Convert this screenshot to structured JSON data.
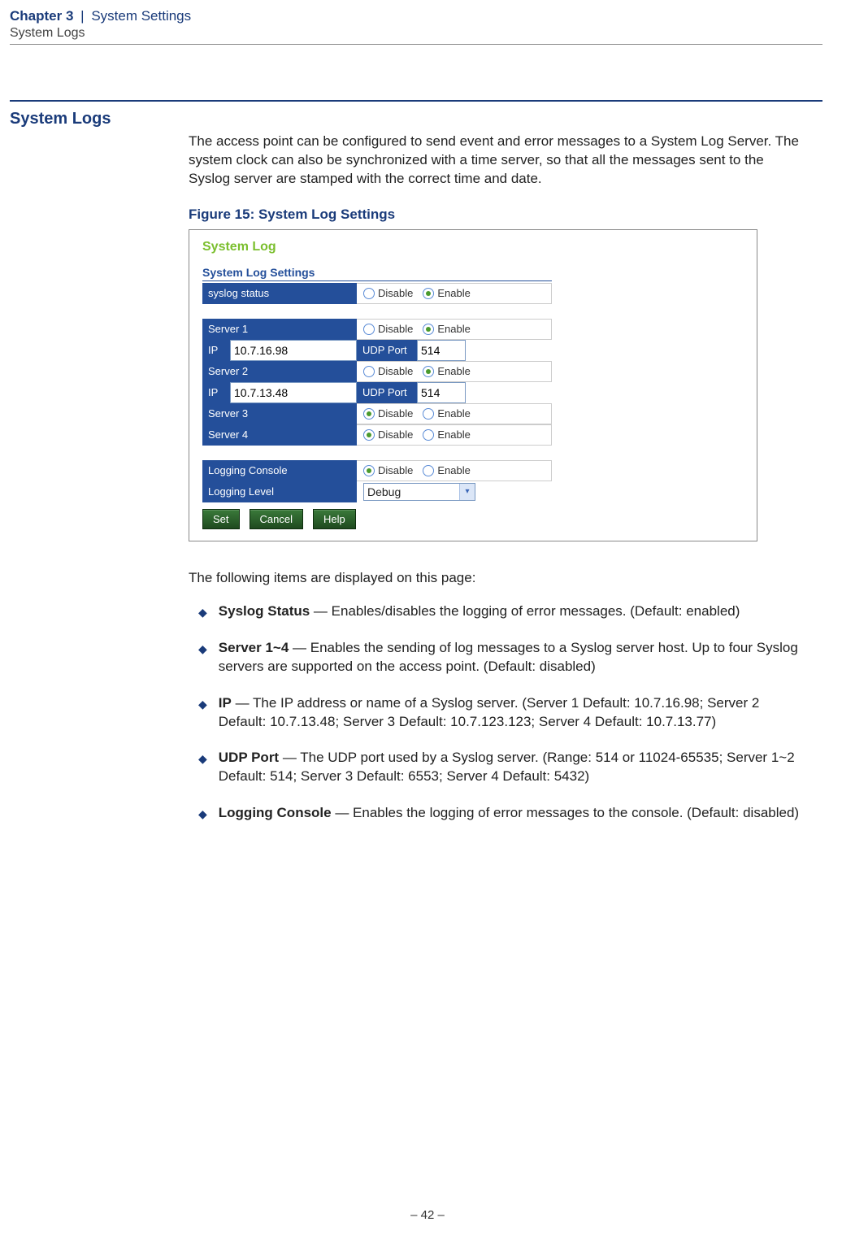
{
  "header": {
    "chapter": "Chapter 3",
    "separator": "|",
    "section": "System Settings",
    "subsection": "System Logs"
  },
  "heading": "System Logs",
  "intro": "The access point can be configured to send event and error messages to a System Log Server. The system clock can also be synchronized with a time server, so that all the messages sent to the Syslog server are stamped with the correct time and date.",
  "figure_caption": "Figure 15:  System Log Settings",
  "shot": {
    "panel_title": "System Log",
    "settings_title": "System Log Settings",
    "labels": {
      "syslog_status": "syslog status",
      "server1": "Server 1",
      "server2": "Server 2",
      "server3": "Server 3",
      "server4": "Server 4",
      "ip": "IP",
      "udp_port": "UDP Port",
      "logging_console": "Logging Console",
      "logging_level": "Logging Level",
      "disable": "Disable",
      "enable": "Enable"
    },
    "values": {
      "syslog_status": "Enable",
      "server1_state": "Enable",
      "server1_ip": "10.7.16.98",
      "server1_port": "514",
      "server2_state": "Enable",
      "server2_ip": "10.7.13.48",
      "server2_port": "514",
      "server3_state": "Disable",
      "server4_state": "Disable",
      "logging_console": "Disable",
      "logging_level": "Debug"
    },
    "buttons": {
      "set": "Set",
      "cancel": "Cancel",
      "help": "Help"
    }
  },
  "desc_intro": "The following items are displayed on this page:",
  "items": [
    {
      "term": "Syslog Status",
      "desc": " — Enables/disables the logging of error messages. (Default: enabled)"
    },
    {
      "term": "Server 1~4",
      "desc": " — Enables the sending of log messages to a Syslog server host. Up to four Syslog servers are supported on the access point. (Default: disabled)"
    },
    {
      "term": "IP",
      "desc": " — The IP address or name of a Syslog server. (Server 1 Default: 10.7.16.98; Server 2 Default: 10.7.13.48; Server 3 Default: 10.7.123.123; Server 4 Default: 10.7.13.77)"
    },
    {
      "term": "UDP  Port",
      "desc": " — The UDP port used by a Syslog server. (Range: 514 or 11024-65535; Server 1~2 Default: 514; Server 3 Default: 6553; Server 4 Default: 5432)"
    },
    {
      "term": "Logging Console",
      "desc": " — Enables the logging of error messages to the console. (Default: disabled)"
    }
  ],
  "page_number": "–  42  –"
}
